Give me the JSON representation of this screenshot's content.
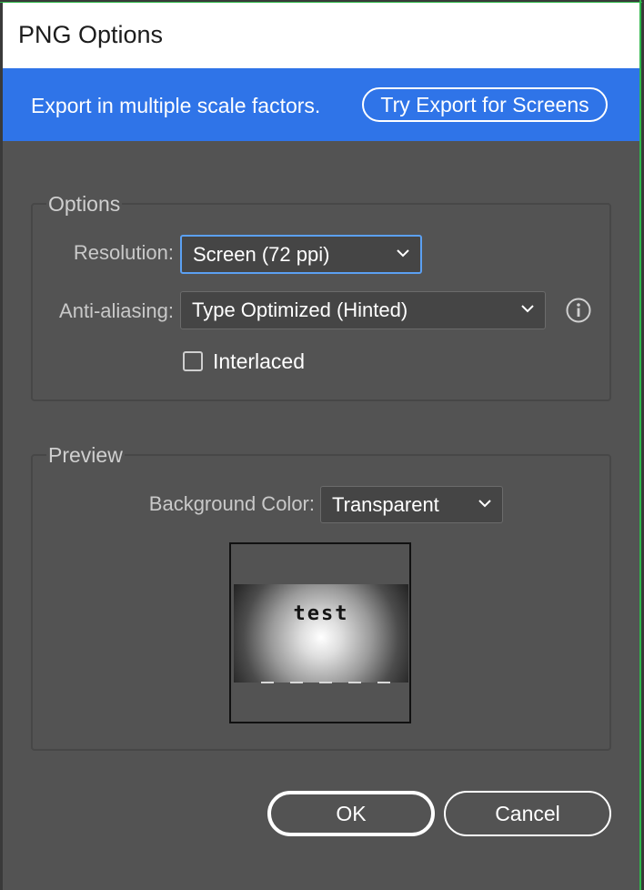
{
  "dialog": {
    "title": "PNG Options"
  },
  "banner": {
    "text": "Export in multiple scale factors.",
    "button_label": "Try Export for Screens"
  },
  "options": {
    "legend": "Options",
    "resolution": {
      "label": "Resolution:",
      "value": "Screen (72 ppi)"
    },
    "anti_aliasing": {
      "label": "Anti-aliasing:",
      "value": "Type Optimized (Hinted)"
    },
    "interlaced": {
      "label": "Interlaced",
      "checked": false
    },
    "info_icon": "info-icon"
  },
  "preview": {
    "legend": "Preview",
    "background_color": {
      "label": "Background Color:",
      "value": "Transparent"
    },
    "thumbnail_text": "test"
  },
  "buttons": {
    "ok_label": "OK",
    "cancel_label": "Cancel"
  },
  "colors": {
    "banner": "#2f74e8",
    "dialog_bg": "#535353",
    "focus_ring": "#5ba0f2"
  }
}
